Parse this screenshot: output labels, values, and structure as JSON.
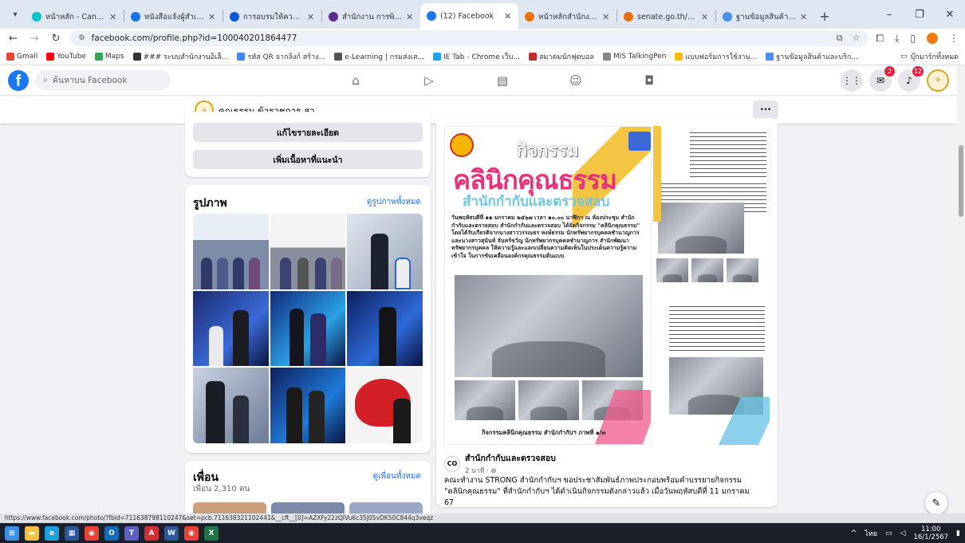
{
  "browser": {
    "tabs": [
      {
        "label": "หน้าหลัก - Canva",
        "color": "#00c4cc",
        "active": false
      },
      {
        "label": "หนังสือแจ้งผู้สำเร็จ",
        "color": "#1a73e8",
        "active": false
      },
      {
        "label": "การอบรมให้ความรู้",
        "color": "#0b57d0",
        "active": false
      },
      {
        "label": "สำนักงาน การพิเศษ",
        "color": "#5b2c8c",
        "active": false
      },
      {
        "label": "(12) Facebook",
        "color": "#1877f2",
        "active": true
      },
      {
        "label": "หน้าหลักสำนักงาน",
        "color": "#e8710a",
        "active": false
      },
      {
        "label": "senate.go.th/view/351/",
        "color": "#e8710a",
        "active": false
      },
      {
        "label": "ฐานข้อมูลสินค้าและบริการ",
        "color": "#4a8ef0",
        "active": false
      }
    ],
    "url": "facebook.com/profile.php?id=100040201864477",
    "bookmarks": [
      {
        "label": "Gmail",
        "color": "#ea4335"
      },
      {
        "label": "YouTube",
        "color": "#ff0000"
      },
      {
        "label": "Maps",
        "color": "#34a853"
      },
      {
        "label": "### ระบบสำนักงานอิเล็...",
        "color": "#333333"
      },
      {
        "label": "รหัส QR จากลิงก์ สร้าง...",
        "color": "#4285f4"
      },
      {
        "label": "e-Learning | กรมส่งเส...",
        "color": "#555555"
      },
      {
        "label": "IE Tab - Chrome เว็บ...",
        "color": "#1da1f2"
      },
      {
        "label": "สมาคมนักฟุตบอล",
        "color": "#c62828"
      },
      {
        "label": "MIS TalkingPen",
        "color": "#888888"
      },
      {
        "label": "แบบฟอร์มการใช้งาน...",
        "color": "#fbbc04"
      },
      {
        "label": "ฐานข้อมูลสินค้าและบริก...",
        "color": "#4a8ef0"
      }
    ],
    "bookmarks_folder": "บุ๊กมาร์กทั้งหมด"
  },
  "facebook": {
    "logo": "f",
    "search_placeholder": "ค้นหาบน Facebook",
    "nav_icons": [
      "home-icon",
      "video-icon",
      "marketplace-icon",
      "groups-icon",
      "gaming-icon"
    ],
    "messenger_badge": "2",
    "notifications_badge": "12",
    "profile": {
      "name": "คุณธรรม ข้าราชการ สว.",
      "more": "···"
    }
  },
  "left_column": {
    "edit_details_button": "แก้ไขรายละเอียด",
    "add_featured_button": "เพิ่มเนื้อหาที่แนะนำ",
    "photos": {
      "title": "รูปภาพ",
      "see_all": "ดูรูปภาพทั้งหมด"
    },
    "friends": {
      "title": "เพื่อน",
      "count": "เพื่อน 2,310 คน",
      "see_all": "ดูเพื่อนทั้งหมด"
    }
  },
  "post": {
    "banner_activity": "กิจกรรม",
    "banner_title": "คลินิกคุณธรรม",
    "banner_subtitle": "สำนักกำกับและตรวจสอบ",
    "banner_body": "วันพฤหัสบดีที่ ๑๑ มกราคม ๒๕๖๗ เวลา ๑๐.๐๐ นาฬิกา ณ ห้องประชุม สำนักกำกับและตรวจสอบ สำนักกำกับและตรวจสอบ ได้จัดกิจกรรม \"คลินิกคุณธรรม\" โดยได้รับเกียรติจากนางสาววรรณธร หงษ์ธรรม นักทรัพยากรบุคคลชำนาญการ และนางสาวสุนันท์ จันทร์ขวัญ นักทรัพยากรบุคคลชำนาญการ สำนักพัฒนาทรัพยากรบุคคล ให้ความรู้และแลกเปลี่ยนความคิดเห็นในประเด็นความรู้ความเข้าใจ ในการขับเคลื่อนองค์กรคุณธรรมต้นแบบ",
    "banner_caption": "กิจกรรมคลินิกคุณธรรม สำนักกำกับฯ ภาพที่ ๑/๓",
    "author": "สำนักกำกับและตรวจสอบ",
    "author_logo": "CO",
    "time": "2 นาที · ⊕",
    "text": "คณะทำงาน STRONG สำนักกำกับฯ ขอประชาสัมพันธ์ภาพประกอบพร้อมคำบรรยายกิจกรรม \"คลินิกคุณธรรม\" ที่สำนักกำกับฯ ได้ดำเนินกิจกรรมดังกล่าวแล้ว เมื่อวันพฤหัสบดีที่ 11 มกราคม 67"
  },
  "status_url": "https://www.facebook.com/photo/?fbid=711638798110247&set=pcb.711638321102441&__cft__[0]=AZXFy22zQIVu6c35J05vDK50C844q3veqz",
  "taskbar": {
    "apps": [
      {
        "name": "windows-start",
        "color": "#3b8eea",
        "glyph": "⊞"
      },
      {
        "name": "file-explorer",
        "color": "#f4c242",
        "glyph": "▬"
      },
      {
        "name": "edge",
        "color": "#1ba1e2",
        "glyph": "e"
      },
      {
        "name": "store",
        "color": "#2b5797",
        "glyph": "▦"
      },
      {
        "name": "chrome",
        "color": "#e94235",
        "glyph": "◉"
      },
      {
        "name": "outlook",
        "color": "#0f6cbd",
        "glyph": "O"
      },
      {
        "name": "teams",
        "color": "#5b5fc7",
        "glyph": "T"
      },
      {
        "name": "acrobat",
        "color": "#d32f2f",
        "glyph": "A"
      },
      {
        "name": "word",
        "color": "#2b579a",
        "glyph": "W"
      },
      {
        "name": "chrome-2",
        "color": "#e94235",
        "glyph": "◉"
      },
      {
        "name": "excel",
        "color": "#217346",
        "glyph": "X"
      }
    ],
    "lang": "ไทย",
    "time": "11:00",
    "date": "16/1/2567"
  }
}
